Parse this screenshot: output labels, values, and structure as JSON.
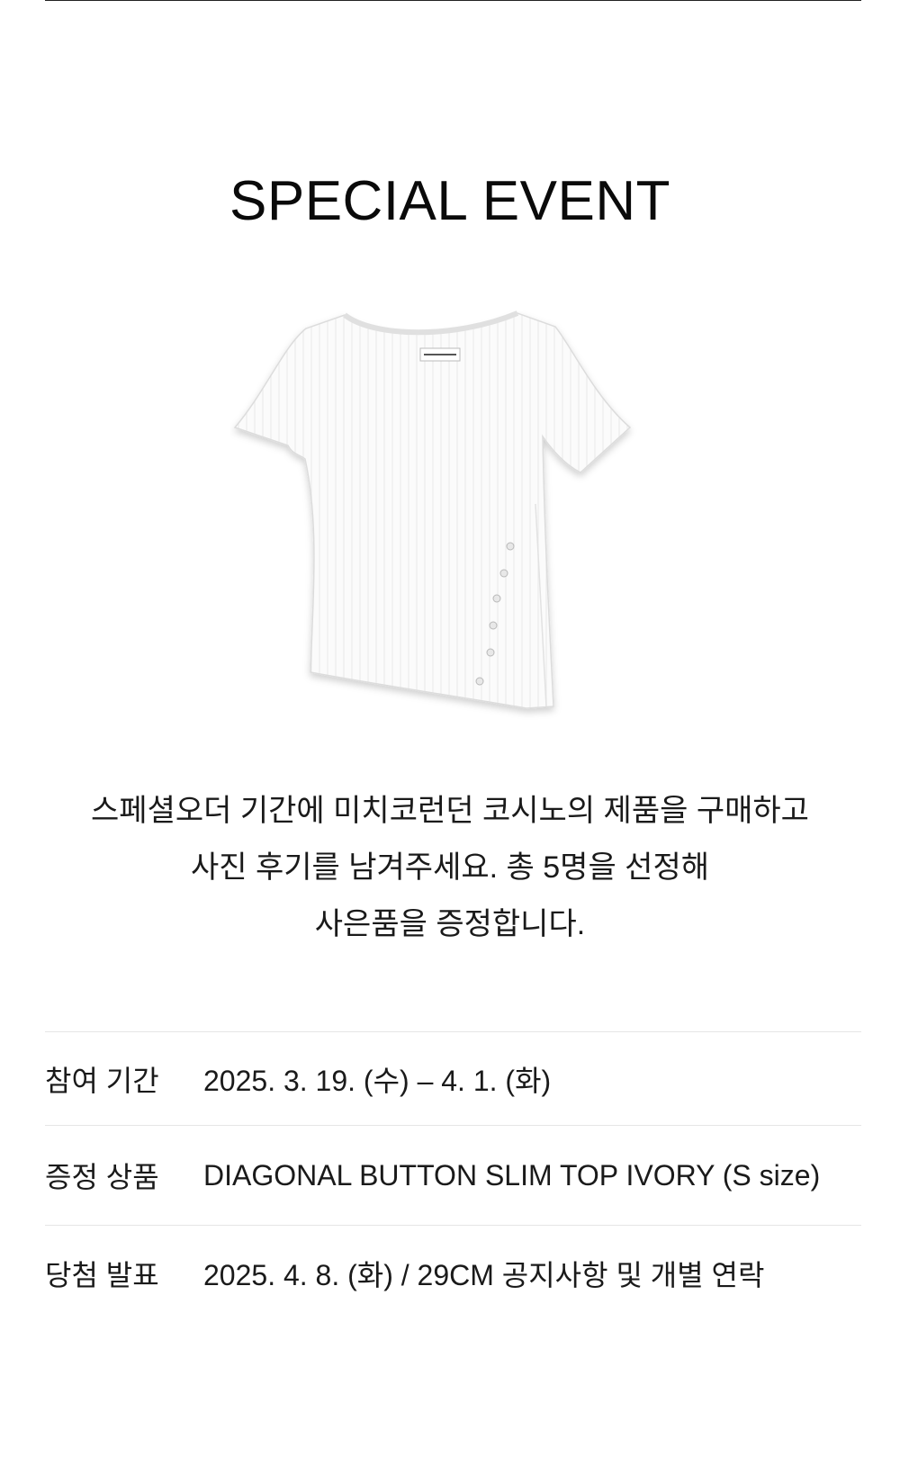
{
  "title": "SPECIAL EVENT",
  "product_image": {
    "alt": "white ribbed short-sleeve top with diagonal buttons"
  },
  "description": [
    "스페셜오더 기간에 미치코런던 코시노의 제품을 구매하고",
    "사진 후기를 남겨주세요. 총 5명을 선정해",
    "사은품을 증정합니다."
  ],
  "info": [
    {
      "label": "참여 기간",
      "value": "2025. 3. 19. (수) – 4. 1. (화)"
    },
    {
      "label": "증정 상품",
      "value": "DIAGONAL BUTTON SLIM TOP IVORY (S size)"
    },
    {
      "label": "당첨 발표",
      "value": "2025. 4. 8. (화) / 29CM 공지사항 및 개별 연락"
    }
  ]
}
